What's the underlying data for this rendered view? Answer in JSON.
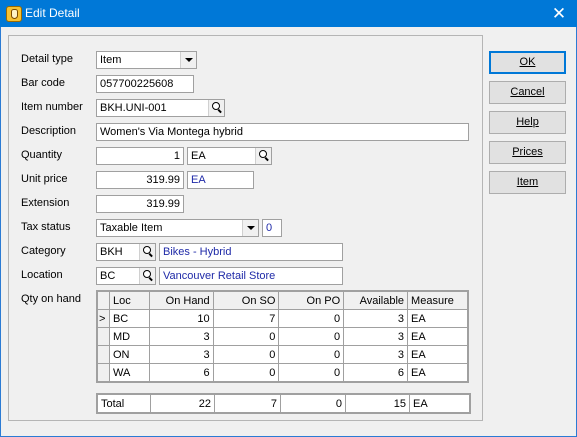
{
  "window": {
    "title": "Edit Detail",
    "close_glyph": "✕"
  },
  "form": {
    "detail_type": {
      "label": "Detail type",
      "value": "Item"
    },
    "bar_code": {
      "label": "Bar code",
      "value": "057700225608"
    },
    "item_number": {
      "label": "Item number",
      "value": "BKH.UNI-001"
    },
    "description": {
      "label": "Description",
      "value": "Women's Via Montega hybrid"
    },
    "quantity": {
      "label": "Quantity",
      "value": "1",
      "unit": "EA"
    },
    "unit_price": {
      "label": "Unit price",
      "value": "319.99",
      "unit": "EA"
    },
    "extension": {
      "label": "Extension",
      "value": "319.99"
    },
    "tax_status": {
      "label": "Tax status",
      "value": "Taxable Item",
      "code": "0"
    },
    "category": {
      "label": "Category",
      "code": "BKH",
      "name": "Bikes - Hybrid"
    },
    "location": {
      "label": "Location",
      "code": "BC",
      "name": "Vancouver Retail Store"
    },
    "qty_on_hand": {
      "label": "Qty on hand"
    }
  },
  "grid": {
    "columns": [
      "Loc",
      "On Hand",
      "On SO",
      "On PO",
      "Available",
      "Measure"
    ],
    "rows": [
      {
        "marker": ">",
        "cells": [
          "BC",
          "10",
          "7",
          "0",
          "3",
          "EA"
        ]
      },
      {
        "marker": "",
        "cells": [
          "MD",
          "3",
          "0",
          "0",
          "3",
          "EA"
        ]
      },
      {
        "marker": "",
        "cells": [
          "ON",
          "3",
          "0",
          "0",
          "3",
          "EA"
        ]
      },
      {
        "marker": "",
        "cells": [
          "WA",
          "6",
          "0",
          "0",
          "6",
          "EA"
        ]
      }
    ],
    "totals": [
      "Total",
      "22",
      "7",
      "0",
      "15",
      "EA"
    ]
  },
  "buttons": {
    "ok": "OK",
    "cancel": "Cancel",
    "help": "Help",
    "prices": "Prices",
    "item": "Item"
  }
}
